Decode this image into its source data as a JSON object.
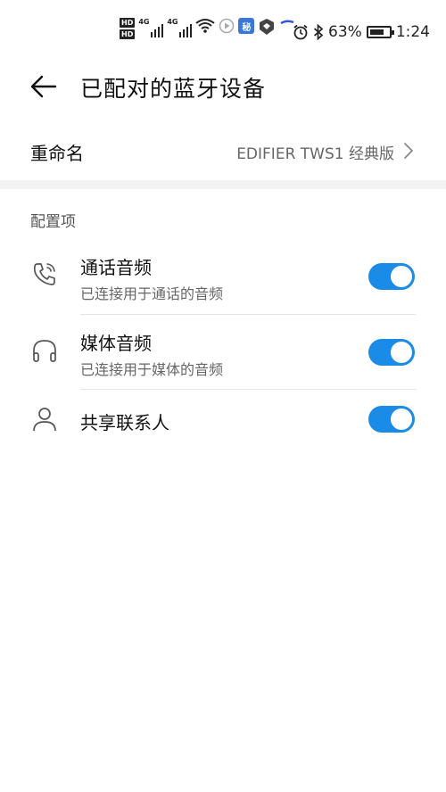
{
  "status_bar": {
    "hd1": "HD",
    "hd2": "HD",
    "sig1_label": "4G",
    "sig2_label": "4G",
    "app_badge": "秘",
    "battery": "63%",
    "time": "1:24"
  },
  "header": {
    "title": "已配对的蓝牙设备"
  },
  "rename": {
    "label": "重命名",
    "value": "EDIFIER TWS1 经典版"
  },
  "section": {
    "title": "配置项"
  },
  "items": [
    {
      "title": "通话音频",
      "subtitle": "已连接用于通话的音频",
      "icon": "phone-icon",
      "enabled": true
    },
    {
      "title": "媒体音频",
      "subtitle": "已连接用于媒体的音频",
      "icon": "headphones-icon",
      "enabled": true
    },
    {
      "title": "共享联系人",
      "subtitle": "",
      "icon": "contact-icon",
      "enabled": true
    }
  ],
  "colors": {
    "toggle_on": "#1a8ce8"
  }
}
